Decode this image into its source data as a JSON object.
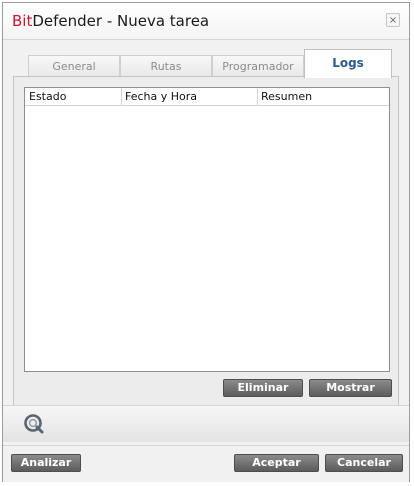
{
  "window": {
    "title_brand": "Bit",
    "title_rest": "Defender - Nueva tarea",
    "close_glyph": "×"
  },
  "tabs": [
    {
      "label": "General",
      "active": false
    },
    {
      "label": "Rutas",
      "active": false
    },
    {
      "label": "Programador",
      "active": false
    },
    {
      "label": "Logs",
      "active": true
    }
  ],
  "logs_table": {
    "columns": [
      "Estado",
      "Fecha y Hora",
      "Resumen"
    ],
    "rows": []
  },
  "panel_buttons": {
    "delete_label": "Eliminar",
    "show_label": "Mostrar"
  },
  "footer_buttons": {
    "scan_label": "Analizar",
    "accept_label": "Aceptar",
    "cancel_label": "Cancelar"
  },
  "icons": {
    "logo": "bitdefender-logo-icon"
  },
  "colors": {
    "brand": "#d0142b",
    "active_tab": "#2c5b93",
    "button": "#6e6e6e"
  }
}
